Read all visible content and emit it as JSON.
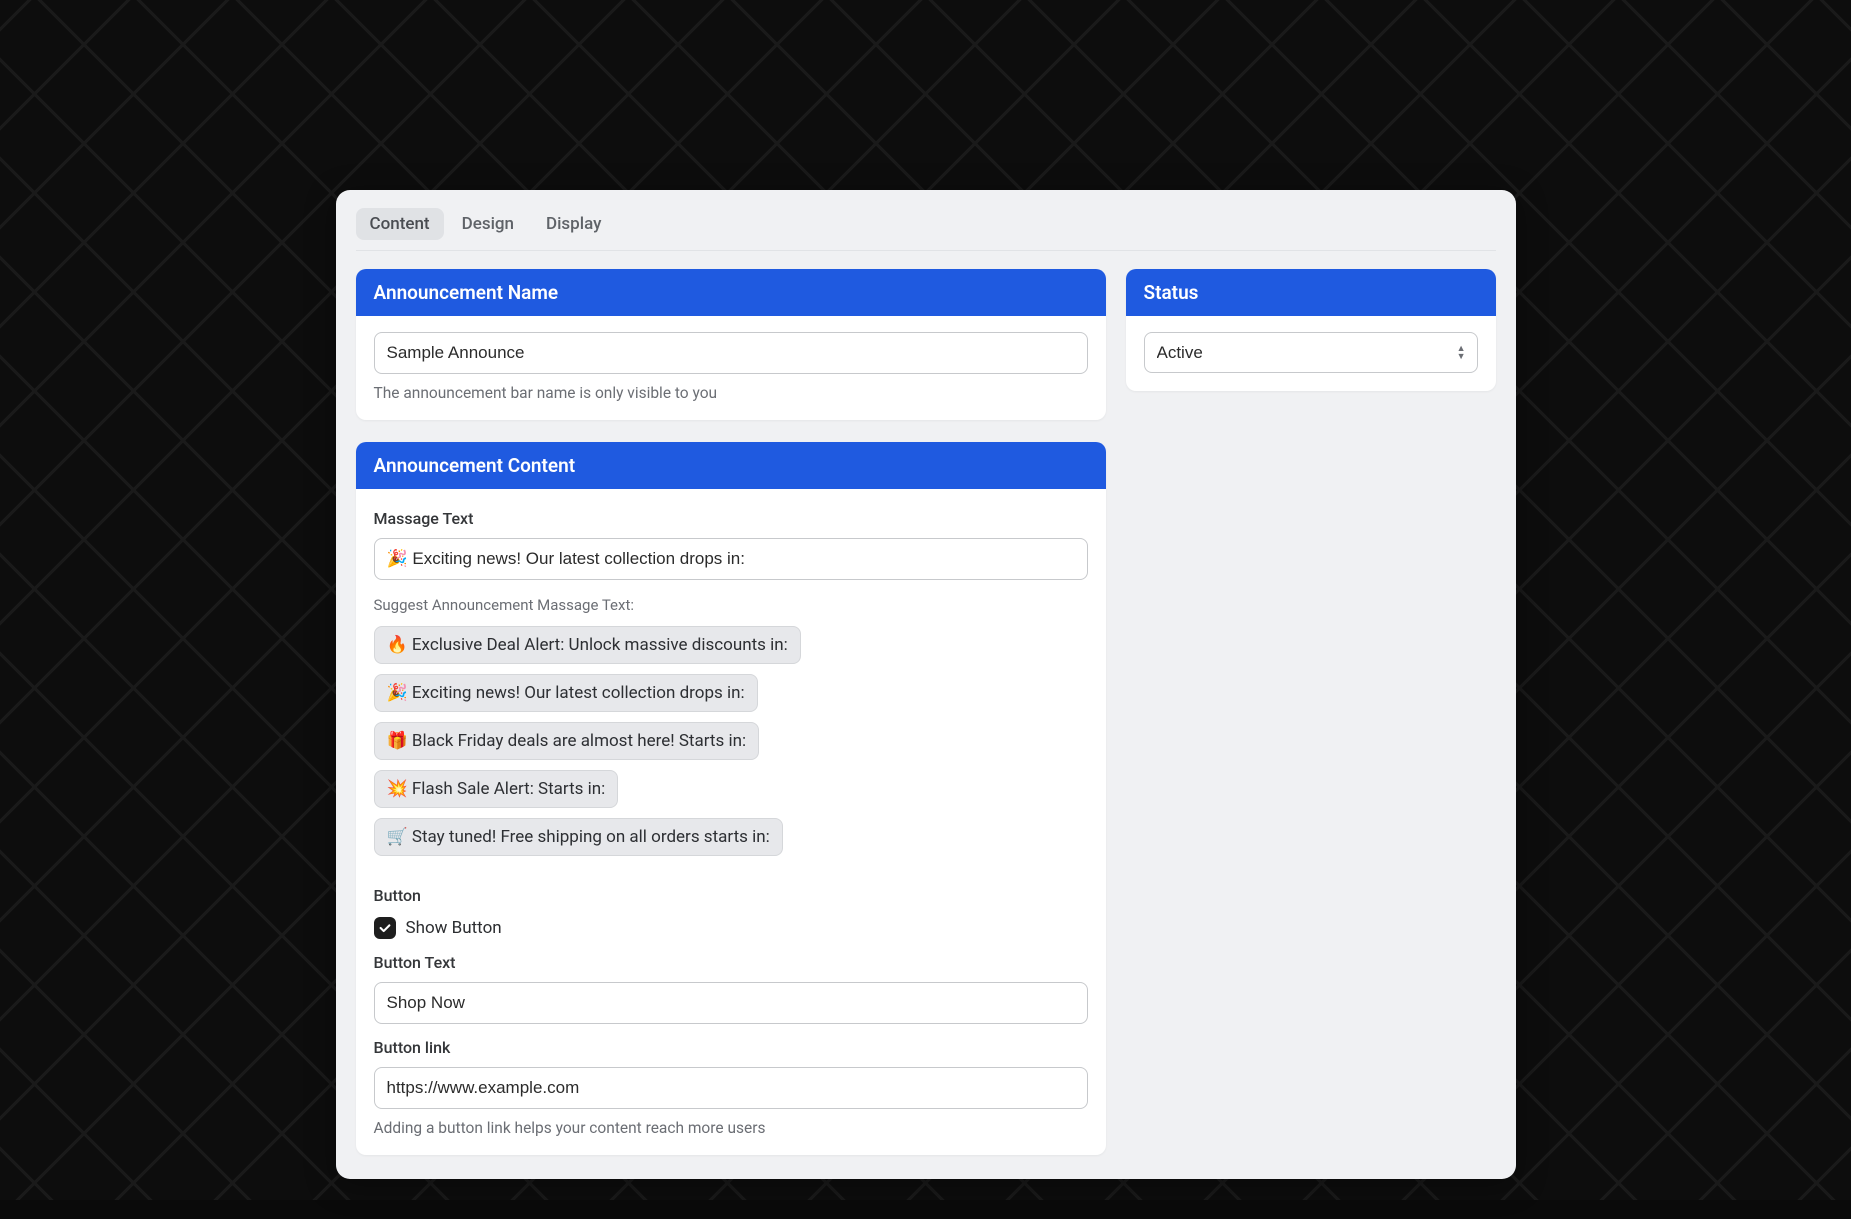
{
  "tabs": {
    "content": "Content",
    "design": "Design",
    "display": "Display"
  },
  "announcement_name": {
    "header": "Announcement Name",
    "value": "Sample Announce",
    "help": "The announcement bar name is only visible to you"
  },
  "status": {
    "header": "Status",
    "value": "Active"
  },
  "announcement_content": {
    "header": "Announcement Content",
    "message_label": "Massage Text",
    "message_value": "🎉 Exciting news! Our latest collection drops in:",
    "suggest_label": "Suggest Announcement Massage Text:",
    "suggestions": [
      "🔥 Exclusive Deal Alert: Unlock massive discounts in:",
      "🎉 Exciting news! Our latest collection drops in:",
      "🎁 Black Friday deals are almost here! Starts in:",
      "💥 Flash Sale Alert: Starts in:",
      "🛒 Stay tuned! Free shipping on all orders starts in:"
    ],
    "button_section_label": "Button",
    "show_button_label": "Show Button",
    "button_text_label": "Button Text",
    "button_text_value": "Shop Now",
    "button_link_label": "Button link",
    "button_link_value": "https://www.example.com",
    "button_link_help": "Adding a button link helps your content reach more users"
  }
}
